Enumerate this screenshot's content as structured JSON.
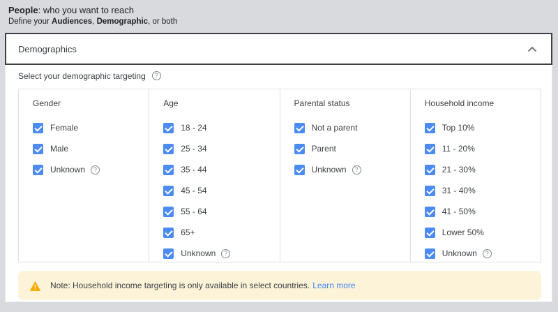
{
  "people": {
    "title_bold": "People",
    "title_rest": ": who you want to reach",
    "subtitle": {
      "prefix": "Define your ",
      "bold1": "Audiences",
      "sep": ", ",
      "bold2": "Demographic",
      "suffix": ", or both"
    }
  },
  "section": {
    "title": "Demographics",
    "chevron_icon": "chevron-up"
  },
  "targeting": {
    "label": "Select your demographic targeting"
  },
  "icons": {
    "help": "?"
  },
  "columns": [
    {
      "title": "Gender",
      "options": [
        {
          "label": "Female",
          "checked": true,
          "help": false
        },
        {
          "label": "Male",
          "checked": true,
          "help": false
        },
        {
          "label": "Unknown",
          "checked": true,
          "help": true
        }
      ]
    },
    {
      "title": "Age",
      "options": [
        {
          "label": "18 - 24",
          "checked": true,
          "help": false
        },
        {
          "label": "25 - 34",
          "checked": true,
          "help": false
        },
        {
          "label": "35 - 44",
          "checked": true,
          "help": false
        },
        {
          "label": "45 - 54",
          "checked": true,
          "help": false
        },
        {
          "label": "55 - 64",
          "checked": true,
          "help": false
        },
        {
          "label": "65+",
          "checked": true,
          "help": false
        },
        {
          "label": "Unknown",
          "checked": true,
          "help": true
        }
      ]
    },
    {
      "title": "Parental status",
      "options": [
        {
          "label": "Not a parent",
          "checked": true,
          "help": false
        },
        {
          "label": "Parent",
          "checked": true,
          "help": false
        },
        {
          "label": "Unknown",
          "checked": true,
          "help": true
        }
      ]
    },
    {
      "title": "Household income",
      "options": [
        {
          "label": "Top 10%",
          "checked": true,
          "help": false
        },
        {
          "label": "11 - 20%",
          "checked": true,
          "help": false
        },
        {
          "label": "21 - 30%",
          "checked": true,
          "help": false
        },
        {
          "label": "31 - 40%",
          "checked": true,
          "help": false
        },
        {
          "label": "41 - 50%",
          "checked": true,
          "help": false
        },
        {
          "label": "Lower 50%",
          "checked": true,
          "help": false
        },
        {
          "label": "Unknown",
          "checked": true,
          "help": true
        }
      ]
    }
  ],
  "note": {
    "text": "Note: Household income targeting is only available in select countries.",
    "link_label": "Learn more"
  },
  "colors": {
    "accent_blue": "#4c8bf4",
    "link_blue": "#4285f4",
    "warning_bg": "#fcf3d8",
    "warning_icon": "#f9ab00"
  }
}
